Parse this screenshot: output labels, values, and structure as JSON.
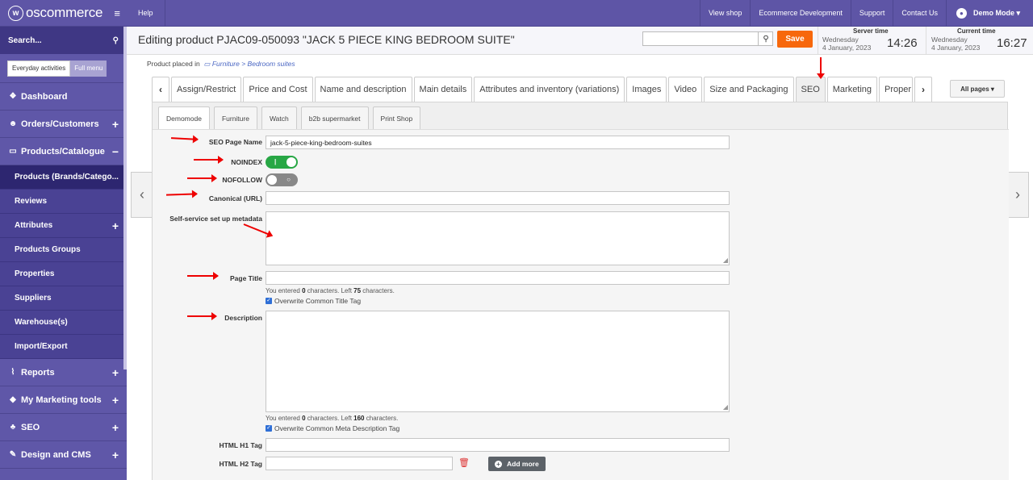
{
  "brand": {
    "logo_text": "oscommerce"
  },
  "sidebar": {
    "search_label": "Search...",
    "mode": {
      "everyday": "Everyday activities",
      "full": "Full menu"
    },
    "items": [
      {
        "label": "Dashboard",
        "icon": "palette-icon"
      },
      {
        "label": "Orders/Customers",
        "icon": "users-icon"
      },
      {
        "label": "Products/Catalogue",
        "icon": "folder-icon"
      }
    ],
    "sub": [
      {
        "label": "Products (Brands/Catego..."
      },
      {
        "label": "Reviews"
      },
      {
        "label": "Attributes"
      },
      {
        "label": "Products Groups"
      },
      {
        "label": "Properties"
      },
      {
        "label": "Suppliers"
      },
      {
        "label": "Warehouse(s)"
      },
      {
        "label": "Import/Export"
      }
    ],
    "bottom": [
      {
        "label": "Reports"
      },
      {
        "label": "My Marketing tools"
      },
      {
        "label": "SEO"
      },
      {
        "label": "Design and CMS"
      }
    ]
  },
  "topbar": {
    "help": "Help",
    "links": [
      "View shop",
      "Ecommerce Development",
      "Support",
      "Contact Us"
    ],
    "user": "Demo Mode"
  },
  "header": {
    "title": "Editing product PJAC09-050093 \"JACK 5 PIECE KING BEDROOM SUITE\"",
    "search_value": "",
    "save": "Save",
    "server_time": {
      "label": "Server time",
      "day": "Wednesday",
      "date": "4 January, 2023",
      "time": "14:26"
    },
    "current_time": {
      "label": "Current time",
      "day": "Wednesday",
      "date": "4 January, 2023",
      "time": "16:27"
    }
  },
  "breadcrumb": {
    "prefix": "Product placed in",
    "category": "Furniture",
    "sub": "Bedroom suites"
  },
  "tabs": [
    "Assign/Restrict",
    "Price and Cost",
    "Name and description",
    "Main details",
    "Attributes and inventory (variations)",
    "Images",
    "Video",
    "Size and Packaging",
    "SEO",
    "Marketing",
    "Proper"
  ],
  "active_tab": "SEO",
  "all_pages": "All pages",
  "store_tabs": [
    "Demomode",
    "Furniture",
    "Watch",
    "b2b supermarket",
    "Print Shop"
  ],
  "form": {
    "seo_page_name": {
      "label": "SEO Page Name",
      "value": "jack-5-piece-king-bedroom-suites"
    },
    "noindex": {
      "label": "NOINDEX",
      "on": true
    },
    "nofollow": {
      "label": "NOFOLLOW",
      "on": false
    },
    "canonical": {
      "label": "Canonical (URL)",
      "value": ""
    },
    "self_service": {
      "label": "Self-service set up metadata"
    },
    "page_title": {
      "label": "Page Title",
      "value": "",
      "hint_pre": "You entered",
      "hint_count": "0",
      "hint_mid": "characters. Left",
      "hint_left": "75",
      "hint_post": "characters.",
      "checkbox": "Overwrite Common Title Tag"
    },
    "description": {
      "label": "Description",
      "hint_pre": "You entered",
      "hint_count": "0",
      "hint_mid": "characters. Left",
      "hint_left": "160",
      "hint_post": "characters.",
      "checkbox": "Overwrite Common Meta Description Tag"
    },
    "h1": {
      "label": "HTML H1 Tag",
      "value": ""
    },
    "h2": {
      "label": "HTML H2 Tag",
      "value": ""
    },
    "add_more": "Add more"
  },
  "colors": {
    "sidebar": "#5f57a8",
    "save": "#f7680c",
    "toggle_on": "#28a745",
    "annotation": "#ee0000"
  }
}
